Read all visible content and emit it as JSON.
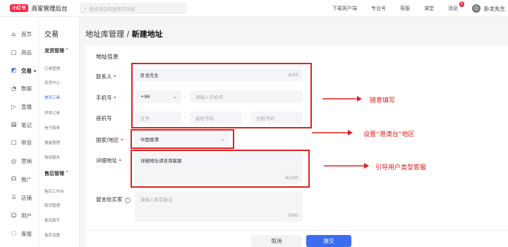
{
  "topbar": {
    "logo": "小红书",
    "brand": "商家管理后台",
    "search_placeholder": "搜索商品和想要的功能",
    "links": [
      "下载客户端",
      "专业号",
      "客服",
      "课堂"
    ],
    "msg_label": "消息",
    "msg_count": "5",
    "username": "卧龙先生"
  },
  "leftnav": {
    "items": [
      {
        "icon": "⌂",
        "label": "首页"
      },
      {
        "icon": "▢",
        "label": "商品"
      },
      {
        "icon": "◩",
        "label": "交易"
      },
      {
        "icon": "◔",
        "label": "数据"
      },
      {
        "icon": "▷",
        "label": "直播"
      },
      {
        "icon": "▤",
        "label": "笔记"
      },
      {
        "icon": "☐",
        "label": "带货"
      },
      {
        "icon": "◎",
        "label": "营销"
      },
      {
        "icon": "☊",
        "label": "推广"
      },
      {
        "icon": "⌸",
        "label": "店铺"
      },
      {
        "icon": "☺",
        "label": "用户"
      },
      {
        "icon": "◌",
        "label": "客服"
      }
    ]
  },
  "subnav": {
    "title": "交易",
    "group1": "发货管理 ˄",
    "group1_items": [
      "订单管理",
      "发货中心",
      "物流工具",
      "异常订单",
      "电子面单",
      "报备管理",
      "物流服务"
    ],
    "group2": "售后管理 ˄",
    "group2_items": [
      "售后工作台",
      "取消管理",
      "售后助手",
      "售后设置"
    ]
  },
  "page": {
    "breadcrumb_parent": "地址库管理",
    "breadcrumb_sep": "/",
    "breadcrumb_current": "新建地址"
  },
  "form": {
    "section": "地址信息",
    "contact_label": "联系人",
    "contact_value": "卧龙先生",
    "contact_count": "4/20",
    "phone_label": "手机号",
    "phone_code": "+86",
    "phone_placeholder": "请输入手机号",
    "landline_label": "座机号",
    "landline_area": "区号",
    "landline_number": "座机号码",
    "landline_ext": "分机号码",
    "region_label": "国家/地区",
    "region_value": "中国香港",
    "address_label": "详细地址",
    "address_value": "详细地址请咨询客服",
    "address_count": "9/100",
    "note_label": "留言给买家",
    "note_placeholder": "请输入售后备注",
    "note_count": "0/60"
  },
  "annotations": {
    "a1": "随意填写",
    "a2": "设置“港澳台”地区",
    "a3": "引导用户类型客服",
    "color": "#e02020"
  },
  "footer": {
    "cancel": "取消",
    "submit": "提交"
  }
}
